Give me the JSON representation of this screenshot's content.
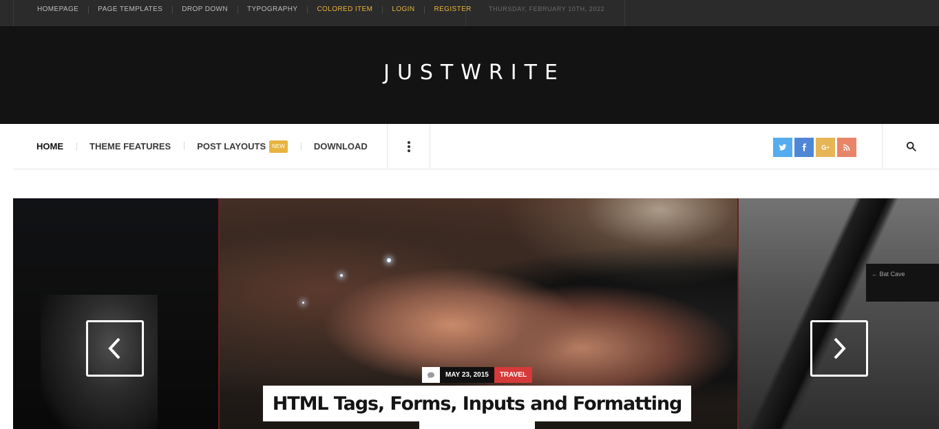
{
  "topbar": {
    "links": [
      "HOMEPAGE",
      "PAGE TEMPLATES",
      "DROP DOWN",
      "TYPOGRAPHY",
      "COLORED ITEM",
      "LOGIN",
      "REGISTER"
    ],
    "colored_links": [
      "COLORED ITEM",
      "LOGIN",
      "REGISTER"
    ],
    "date": "THURSDAY, FEBRUARY 10TH, 2022"
  },
  "header": {
    "logo": "JUSTWRITE"
  },
  "mainnav": {
    "items": [
      {
        "label": "HOME"
      },
      {
        "label": "THEME FEATURES"
      },
      {
        "label": "POST LAYOUTS",
        "badge": "NEW"
      },
      {
        "label": "DOWNLOAD"
      }
    ],
    "more_icon": "vertical-dots-icon",
    "socials": [
      {
        "name": "twitter-icon",
        "color": "#55acee"
      },
      {
        "name": "facebook-icon",
        "color": "#4f87d6"
      },
      {
        "name": "google-plus-icon",
        "color": "#e6b555"
      },
      {
        "name": "rss-icon",
        "color": "#e8846a"
      }
    ],
    "search_icon": "search-icon"
  },
  "slider": {
    "right_sign": "Bat Cave",
    "post": {
      "date": "MAY 23, 2015",
      "category": "TRAVEL",
      "title": "HTML Tags, Forms, Inputs and Formatting"
    }
  },
  "colors": {
    "accent": "#e7b43f",
    "category": "#d63a3a",
    "header_bg": "#131313",
    "topbar_bg": "#2b2b2b"
  }
}
